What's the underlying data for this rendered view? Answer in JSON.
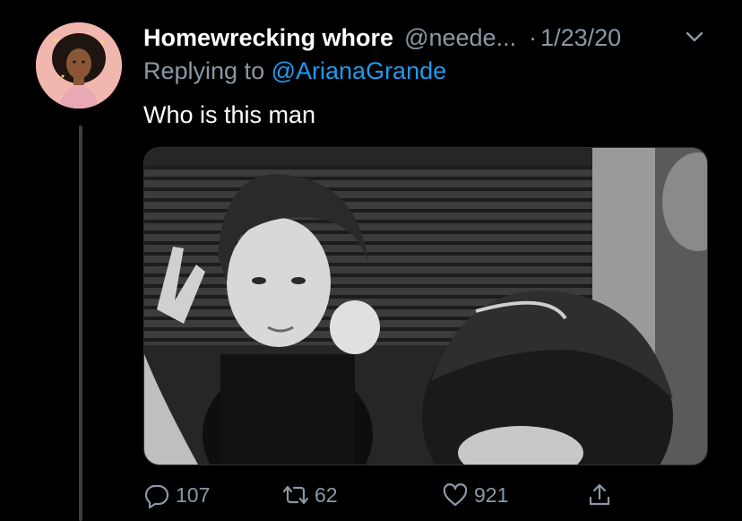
{
  "tweet": {
    "display_name": "Homewrecking whore",
    "handle": "@neede...",
    "separator": "·",
    "date": "1/23/20",
    "reply_prefix": "Replying to",
    "reply_mention": "@ArianaGrande",
    "text": "Who is this man"
  },
  "actions": {
    "replies": "107",
    "retweets": "62",
    "likes": "921"
  },
  "icons": {
    "more": "chevron-down-icon",
    "reply": "speech-bubble-icon",
    "retweet": "retweet-icon",
    "like": "heart-icon",
    "share": "share-icon"
  },
  "colors": {
    "background": "#000000",
    "secondary_text": "#8b98a5",
    "link": "#1d9bf0"
  }
}
